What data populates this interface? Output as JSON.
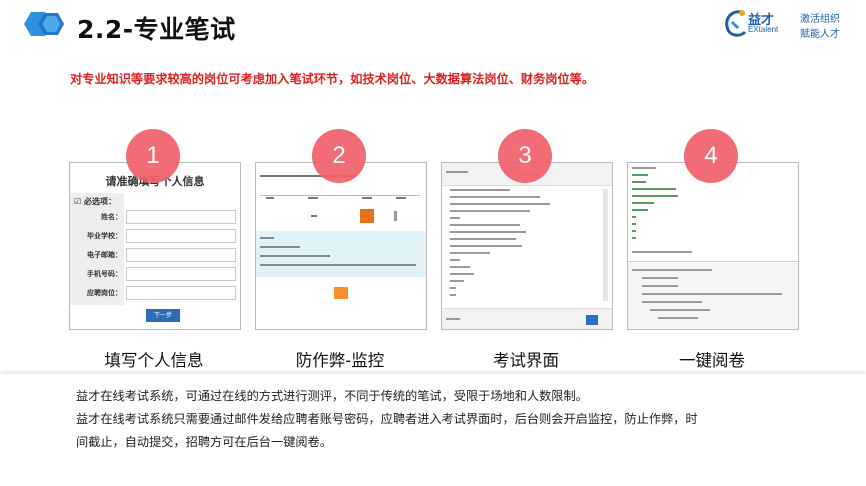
{
  "header": {
    "title": "2.2-专业笔试",
    "brand_cn": "益才",
    "brand_en": "EXtalent",
    "slogan_line1": "激活组织",
    "slogan_line2": "赋能人才"
  },
  "subtitle": "对专业知识等要求较高的岗位可考虑加入笔试环节，如技术岗位、大数据算法岗位、财务岗位等。",
  "colors": {
    "accent_red": "#e02020",
    "badge": "#f0606c",
    "brand_blue": "#1f5fa8"
  },
  "steps": [
    {
      "number": "1",
      "caption": "填写个人信息"
    },
    {
      "number": "2",
      "caption": "防作弊-监控"
    },
    {
      "number": "3",
      "caption": "考试界面"
    },
    {
      "number": "4",
      "caption": "一键阅卷"
    }
  ],
  "form_card": {
    "title": "请准确填写个人信息",
    "required_label": "☑ 必选项：",
    "fields": [
      "姓名：",
      "毕业学校：",
      "电子邮箱：",
      "手机号码：",
      "应聘岗位："
    ],
    "submit_label": "下一步"
  },
  "description": {
    "line1": "益才在线考试系统，可通过在线的方式进行测评，不同于传统的笔试，受限于场地和人数限制。",
    "line2": "益才在线考试系统只需要通过邮件发给应聘者账号密码，应聘者进入考试界面时，后台则会开启监控，防止作弊，时",
    "line3": "间截止，自动提交，招聘方可在后台一键阅卷。"
  }
}
